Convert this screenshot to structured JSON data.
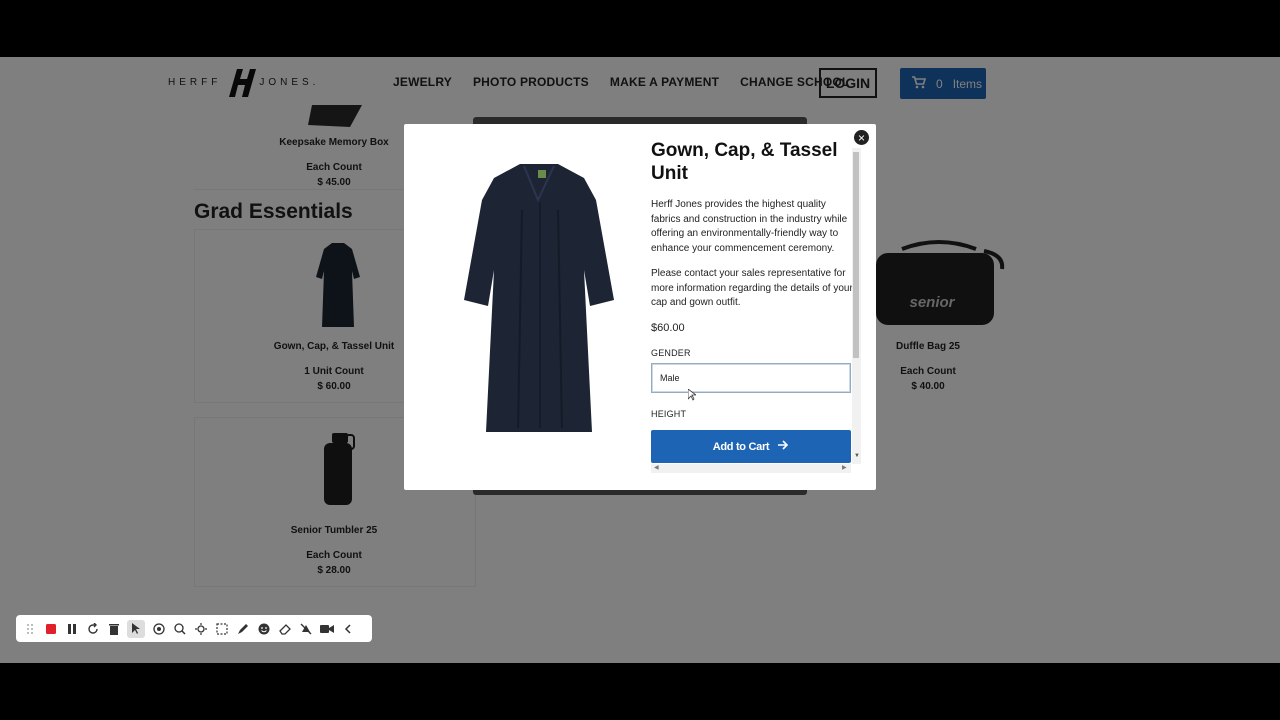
{
  "header": {
    "logo_text_left": "HERFF",
    "logo_text_right": "JONES.",
    "nav": [
      "JEWELRY",
      "PHOTO PRODUCTS",
      "MAKE A PAYMENT",
      "CHANGE SCHOOL"
    ],
    "login_label": "LOGIN",
    "cart_count": "0",
    "cart_label": "Items"
  },
  "products_top": {
    "name": "Keepsake Memory Box",
    "count": "Each  Count",
    "price": "$ 45.00"
  },
  "section_title": "Grad Essentials",
  "products": [
    {
      "name": "Gown, Cap, & Tassel Unit",
      "count": "1 Unit  Count",
      "price": "$ 60.00"
    },
    {
      "name": "Duffle Bag 25",
      "count": "Each  Count",
      "price": "$ 40.00"
    },
    {
      "name": "Senior Tumbler 25",
      "count": "Each  Count",
      "price": "$ 28.00"
    }
  ],
  "duffle_print": "senior",
  "modal": {
    "title": "Gown, Cap, & Tassel Unit",
    "description": "Herff Jones provides the highest quality fabrics and construction in the industry while offering an environmentally-friendly way to enhance your commencement ceremony.",
    "description2": "Please contact your sales representative for more information regarding the details of your cap and gown outfit.",
    "price": "$60.00",
    "gender_label": "GENDER",
    "gender_value": "Male",
    "height_label": "HEIGHT",
    "add_to_cart": "Add to Cart",
    "close_symbol": "×"
  },
  "colors": {
    "brand_blue": "#1e64b4",
    "gown_navy": "#1d2433",
    "record_red": "#e0202a"
  }
}
